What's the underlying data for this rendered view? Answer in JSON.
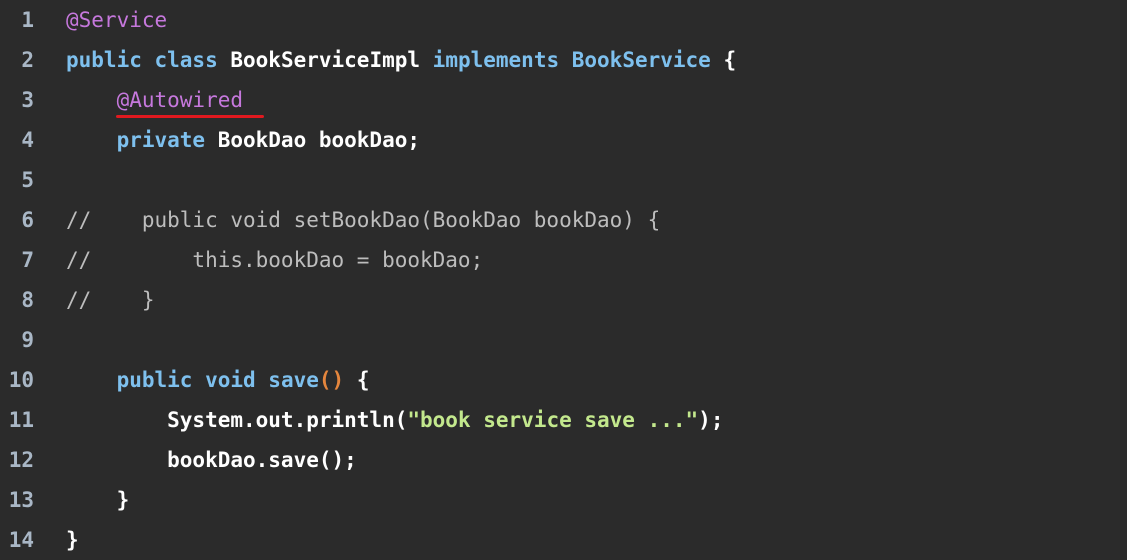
{
  "lines": [
    {
      "num": "1",
      "tokens": [
        {
          "t": "@Service",
          "c": "ann"
        }
      ]
    },
    {
      "num": "2",
      "tokens": [
        {
          "t": "public class ",
          "c": "kw"
        },
        {
          "t": "BookServiceImpl ",
          "c": "cls"
        },
        {
          "t": "implements ",
          "c": "kw"
        },
        {
          "t": "BookService ",
          "c": "kw"
        },
        {
          "t": "{",
          "c": "punct"
        }
      ]
    },
    {
      "num": "3",
      "tokens": [
        {
          "t": "    @Autowired",
          "c": "ann"
        }
      ]
    },
    {
      "num": "4",
      "tokens": [
        {
          "t": "    private ",
          "c": "kw"
        },
        {
          "t": "BookDao bookDao;",
          "c": "plain"
        }
      ]
    },
    {
      "num": "5",
      "tokens": []
    },
    {
      "num": "6",
      "tokens": [
        {
          "t": "//    public void setBookDao(BookDao bookDao) {",
          "c": "cmt"
        }
      ]
    },
    {
      "num": "7",
      "tokens": [
        {
          "t": "//        this.bookDao = bookDao;",
          "c": "cmt"
        }
      ]
    },
    {
      "num": "8",
      "tokens": [
        {
          "t": "//    }",
          "c": "cmt"
        }
      ]
    },
    {
      "num": "9",
      "tokens": []
    },
    {
      "num": "10",
      "tokens": [
        {
          "t": "    public void ",
          "c": "kw"
        },
        {
          "t": "save",
          "c": "kw"
        },
        {
          "t": "()",
          "c": "paren"
        },
        {
          "t": " {",
          "c": "punct"
        }
      ]
    },
    {
      "num": "11",
      "tokens": [
        {
          "t": "        System.out.println(",
          "c": "plain"
        },
        {
          "t": "\"book service save ...\"",
          "c": "str"
        },
        {
          "t": ");",
          "c": "plain"
        }
      ]
    },
    {
      "num": "12",
      "tokens": [
        {
          "t": "        bookDao.save();",
          "c": "plain"
        }
      ]
    },
    {
      "num": "13",
      "tokens": [
        {
          "t": "    }",
          "c": "punct"
        }
      ]
    },
    {
      "num": "14",
      "tokens": [
        {
          "t": "}",
          "c": "punct"
        }
      ]
    }
  ],
  "colors": {
    "background": "#2b2b2b",
    "annotation": "#c678dd",
    "keyword": "#7ec0ee",
    "string": "#c3e88d",
    "comment": "#bdbdbd",
    "highlight_underline": "#e0191f"
  }
}
